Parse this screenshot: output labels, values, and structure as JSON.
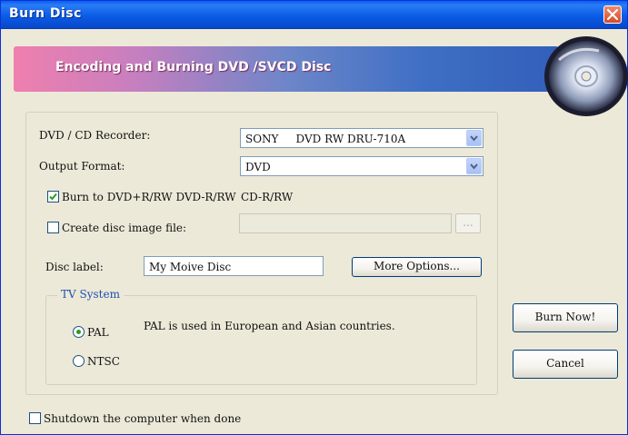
{
  "window": {
    "title": "Burn Disc"
  },
  "banner": {
    "text": "Encoding and Burning DVD /SVCD Disc"
  },
  "recorder": {
    "label": "DVD / CD Recorder:",
    "value": "SONY     DVD RW DRU-710A"
  },
  "output_format": {
    "label": "Output Format:",
    "value": "DVD"
  },
  "burn_to": {
    "label": "Burn to DVD+R/RW DVD-R/RW",
    "suffix": "CD-R/RW",
    "checked": true
  },
  "disc_image": {
    "label": "Create disc image file:",
    "value": "",
    "checked": false,
    "browse": "..."
  },
  "disc_label": {
    "label": "Disc label:",
    "value": "My Moive Disc"
  },
  "buttons": {
    "more_options": "More Options...",
    "burn_now": "Burn Now!",
    "cancel": "Cancel"
  },
  "tv_system": {
    "title": "TV System",
    "options": [
      {
        "label": "PAL",
        "selected": true
      },
      {
        "label": "NTSC",
        "selected": false
      }
    ],
    "description": "PAL is used in European and Asian countries."
  },
  "shutdown": {
    "label": "Shutdown the computer when done",
    "checked": false
  },
  "colors": {
    "title_bar": "#0a5ff0",
    "dialog_bg": "#ece9d8",
    "group_title": "#1e50b0",
    "close_button": "#d74a26"
  },
  "icons": [
    "close-icon",
    "disc-icon",
    "chevron-down-icon",
    "checkmark-icon"
  ]
}
